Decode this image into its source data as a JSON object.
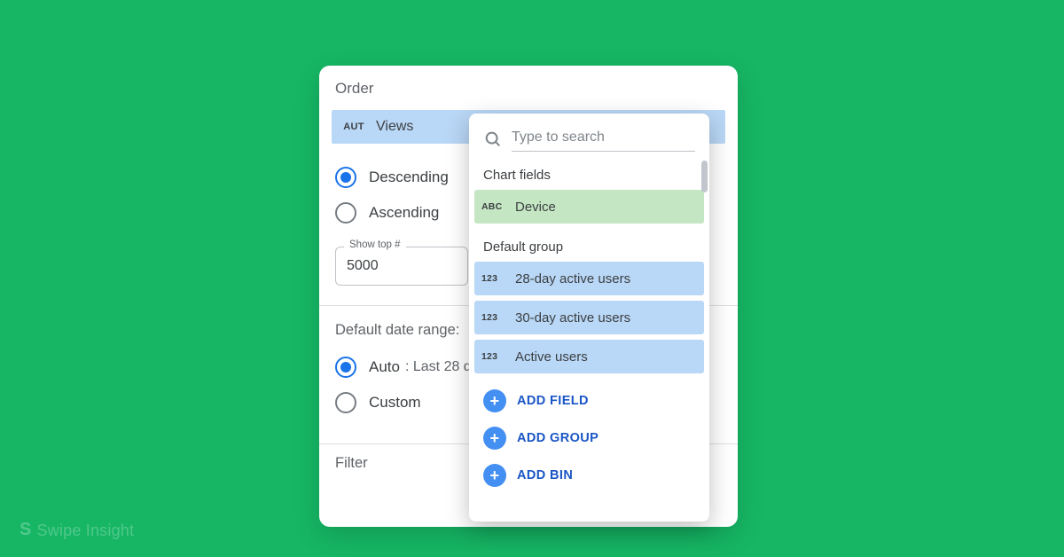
{
  "watermark": "Swipe Insight",
  "panel": {
    "title": "Order",
    "field": {
      "type_badge": "AUT",
      "label": "Views"
    },
    "sort_options": {
      "descending": "Descending",
      "ascending": "Ascending",
      "selected": "descending"
    },
    "show_top": {
      "label": "Show top #",
      "value": "5000"
    },
    "date_range": {
      "title": "Default date range:",
      "auto_label": "Auto",
      "auto_suffix": ": Last 28 d",
      "custom_label": "Custom",
      "selected": "auto"
    },
    "filter_title": "Filter"
  },
  "popover": {
    "search_placeholder": "Type to search",
    "section_chart_fields": "Chart fields",
    "section_default_group": "Default group",
    "items": {
      "device": {
        "type": "ABC",
        "label": "Device"
      },
      "u28": {
        "type": "123",
        "label": "28-day active users"
      },
      "u30": {
        "type": "123",
        "label": "30-day active users"
      },
      "active": {
        "type": "123",
        "label": "Active users"
      }
    },
    "actions": {
      "add_field": "ADD FIELD",
      "add_group": "ADD GROUP",
      "add_bin": "ADD BIN"
    }
  }
}
